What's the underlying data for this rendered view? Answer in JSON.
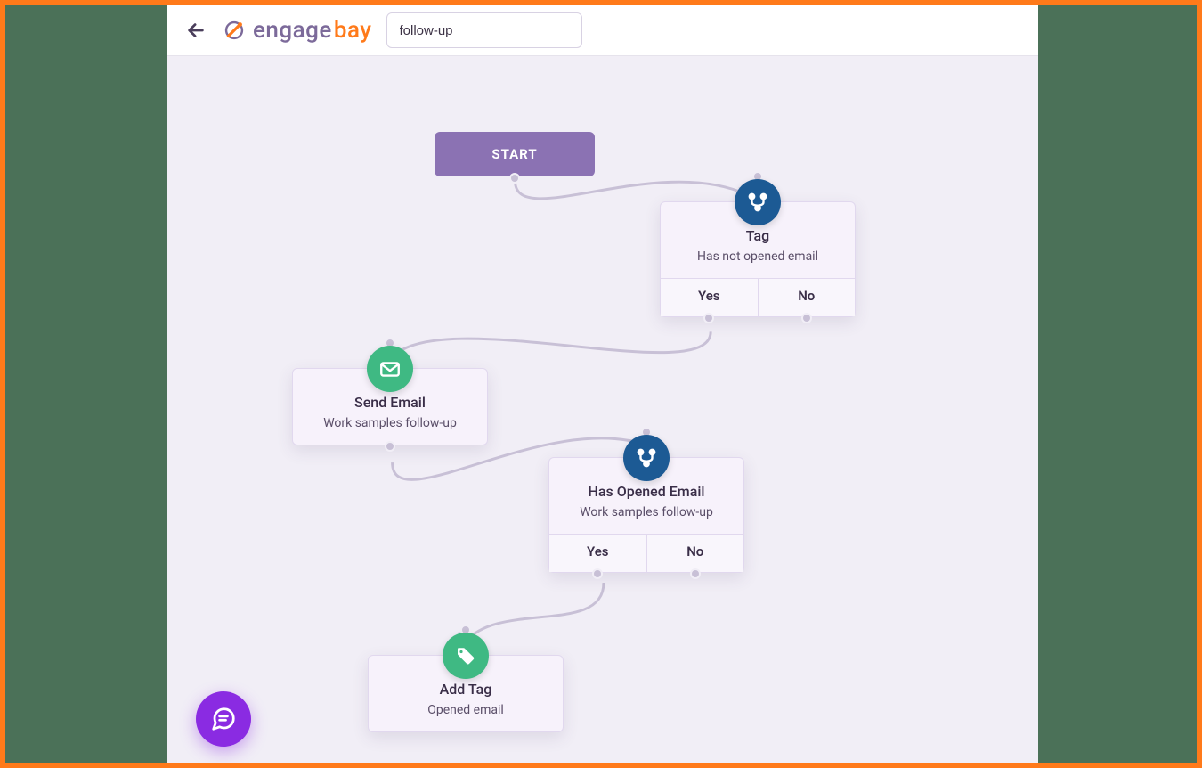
{
  "header": {
    "workflow_name": "follow-up",
    "logo_engage": "engage",
    "logo_bay": "bay"
  },
  "nodes": {
    "start": {
      "label": "START"
    },
    "tag_check": {
      "title": "Tag",
      "subtitle": "Has not opened email",
      "yes": "Yes",
      "no": "No"
    },
    "send_email": {
      "title": "Send Email",
      "subtitle": "Work samples follow-up"
    },
    "opened_check": {
      "title": "Has Opened Email",
      "subtitle": "Work samples follow-up",
      "yes": "Yes",
      "no": "No"
    },
    "add_tag": {
      "title": "Add Tag",
      "subtitle": "Opened email"
    }
  }
}
